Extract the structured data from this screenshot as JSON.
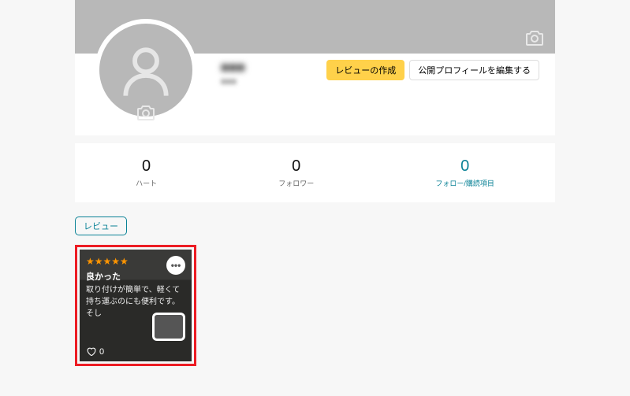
{
  "profile": {
    "username": "■■■",
    "subtext": "■■■"
  },
  "buttons": {
    "create_review": "レビューの作成",
    "edit_profile": "公開プロフィールを編集する"
  },
  "stats": {
    "hearts": {
      "count": "0",
      "label": "ハート"
    },
    "followers": {
      "count": "0",
      "label": "フォロワー"
    },
    "follows": {
      "count": "0",
      "label": "フォロー/購読項目"
    }
  },
  "tabs": {
    "reviews": "レビュー"
  },
  "review": {
    "rating": "★★★★★",
    "title": "良かった",
    "body": "取り付けが簡単で、軽くて持ち運ぶのにも便利です。そし",
    "likes": "0"
  }
}
